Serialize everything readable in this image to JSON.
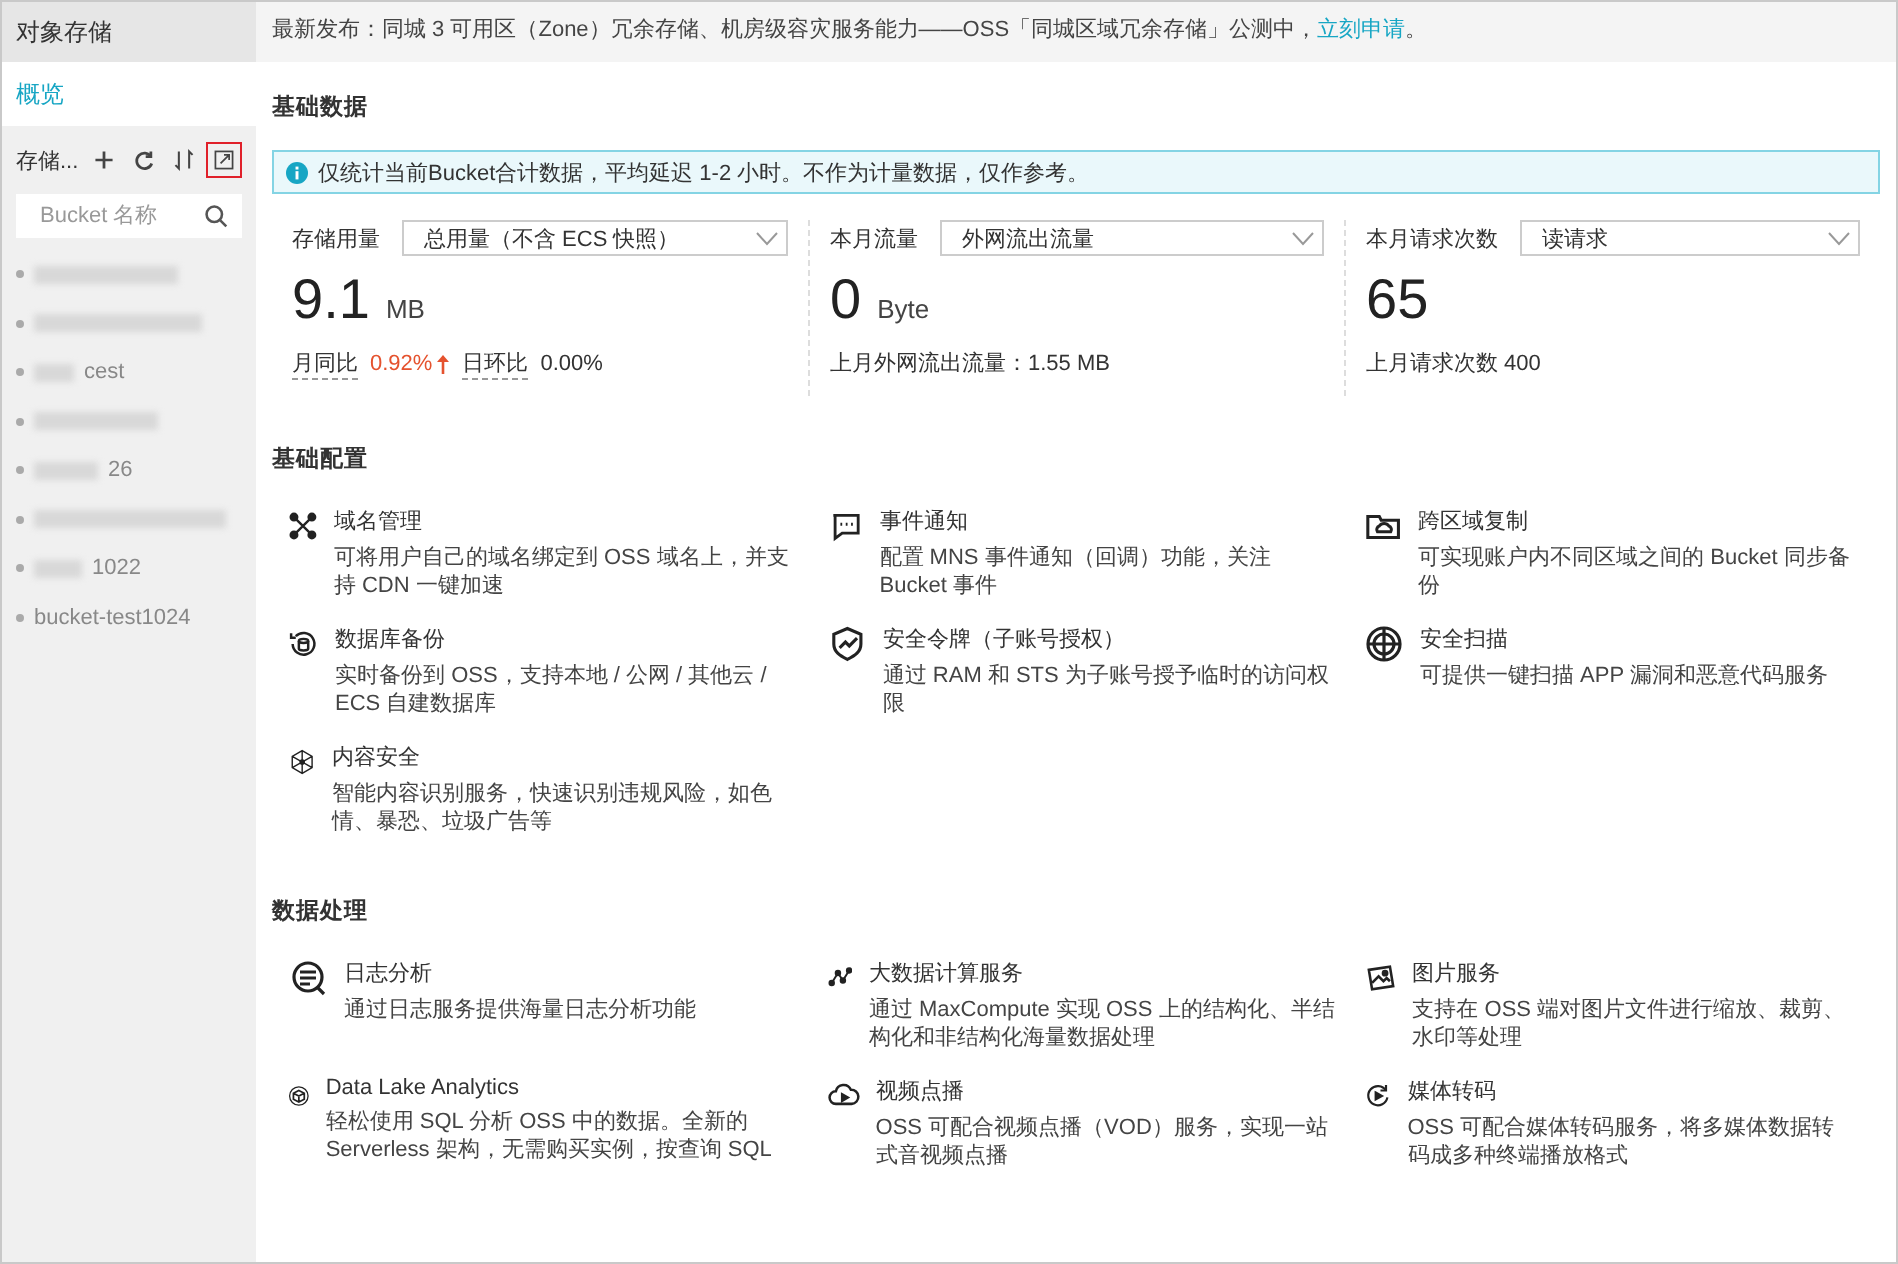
{
  "sidebar": {
    "title": "对象存储",
    "nav": [
      {
        "label": "概览",
        "selected": true
      }
    ],
    "bucket_header": {
      "label": "存储...",
      "tools": [
        {
          "kind": "add",
          "highlighted": false
        },
        {
          "kind": "refresh",
          "highlighted": false
        },
        {
          "kind": "sort",
          "highlighted": false
        },
        {
          "kind": "expand",
          "highlighted": true
        }
      ]
    },
    "search": {
      "placeholder": "Bucket 名称"
    },
    "buckets": [
      {
        "kind": "blurred"
      },
      {
        "kind": "blurred"
      },
      {
        "kind": "partial",
        "text": "cest"
      },
      {
        "kind": "blurred"
      },
      {
        "kind": "partial",
        "text": "26"
      },
      {
        "kind": "blurred"
      },
      {
        "kind": "partial",
        "text": "1022"
      },
      {
        "kind": "plain",
        "text": "bucket-test1024"
      }
    ]
  },
  "announcement": {
    "text": "最新发布：同城 3 可用区（Zone）冗余存储、机房级容灾服务能力——OSS「同城区域冗余存储」公测中，",
    "link": "立刻申请",
    "end": "。"
  },
  "basic_data": {
    "title": "基础数据",
    "notice": "仅统计当前Bucket合计数据，平均延迟 1-2 小时。不作为计量数据，仅作参考。",
    "cards": [
      {
        "label": "存储用量",
        "select": "总用量（不含 ECS 快照）",
        "value": "9.1",
        "unit": "MB",
        "footer": [
          {
            "kind": "label",
            "text": "月同比"
          },
          {
            "kind": "rise",
            "text": "0.92%"
          },
          {
            "kind": "label",
            "text": "日环比"
          },
          {
            "kind": "plain",
            "text": "0.00%"
          }
        ]
      },
      {
        "label": "本月流量",
        "select": "外网流出流量",
        "value": "0",
        "unit": "Byte",
        "footer": [
          {
            "kind": "plain",
            "text": "上月外网流出流量：1.55 MB"
          }
        ]
      },
      {
        "label": "本月请求次数",
        "select": "读请求",
        "value": "65",
        "footer": [
          {
            "kind": "plain",
            "text": "上月请求次数 400"
          }
        ]
      }
    ]
  },
  "sections": [
    {
      "title": "基础配置",
      "items": [
        {
          "kind": "nodes",
          "title": "域名管理",
          "desc": "可将用户自己的域名绑定到 OSS 域名上，并支持 CDN 一键加速"
        },
        {
          "kind": "message",
          "title": "事件通知",
          "desc": "配置 MNS 事件通知（回调）功能，关注 Bucket 事件"
        },
        {
          "kind": "folder-cloud",
          "title": "跨区域复制",
          "desc": "可实现账户内不同区域之间的 Bucket 同步备份"
        },
        {
          "kind": "database",
          "title": "数据库备份",
          "desc": "实时备份到 OSS，支持本地 / 公网 / 其他云 / ECS 自建数据库"
        },
        {
          "kind": "shield",
          "title": "安全令牌（子账号授权）",
          "desc": "通过 RAM 和 STS 为子账号授予临时的访问权限"
        },
        {
          "kind": "radar",
          "title": "安全扫描",
          "desc": "可提供一键扫描 APP 漏洞和恶意代码服务"
        },
        {
          "kind": "mesh",
          "title": "内容安全",
          "desc": "智能内容识别服务，快速识别违规风险，如色情、暴恐、垃圾广告等"
        }
      ]
    },
    {
      "title": "数据处理",
      "items": [
        {
          "kind": "log",
          "title": "日志分析",
          "desc": "通过日志服务提供海量日志分析功能"
        },
        {
          "kind": "graph",
          "title": "大数据计算服务",
          "desc": "通过 MaxCompute 实现 OSS 上的结构化、半结构化和非结构化海量数据处理"
        },
        {
          "kind": "image",
          "title": "图片服务",
          "desc": "支持在 OSS 端对图片文件进行缩放、裁剪、水印等处理"
        },
        {
          "kind": "cube",
          "title": "Data Lake Analytics",
          "desc": "轻松使用 SQL 分析 OSS 中的数据。全新的 Serverless 架构，无需购买实例，按查询 SQL"
        },
        {
          "kind": "cloud-play",
          "title": "视频点播",
          "desc": "OSS 可配合视频点播（VOD）服务，实现一站式音视频点播"
        },
        {
          "kind": "cycle-play",
          "title": "媒体转码",
          "desc": "OSS 可配合媒体转码服务，将多媒体数据转码成多种终端播放格式"
        }
      ]
    }
  ]
}
